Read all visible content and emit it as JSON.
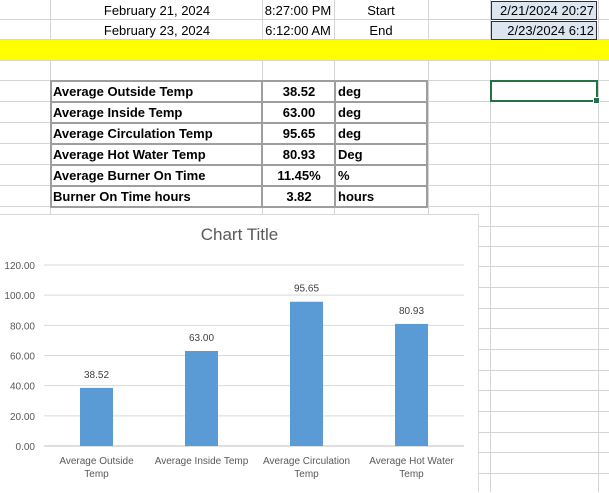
{
  "rows": {
    "start": {
      "date": "February 21, 2024",
      "time": "8:27:00 PM",
      "label": "Start",
      "datetime": "2/21/2024 20:27"
    },
    "end": {
      "date": "February 23, 2024",
      "time": "6:12:00 AM",
      "label": "End",
      "datetime": "2/23/2024 6:12"
    }
  },
  "summary": [
    {
      "label": "Average Outside Temp",
      "value": "38.52",
      "unit": "deg"
    },
    {
      "label": "Average Inside Temp",
      "value": "63.00",
      "unit": "deg"
    },
    {
      "label": "Average Circulation Temp",
      "value": "95.65",
      "unit": "deg"
    },
    {
      "label": "Average Hot Water Temp",
      "value": "80.93",
      "unit": "Deg"
    },
    {
      "label": "Average Burner On Time",
      "value": "11.45%",
      "unit": "%"
    },
    {
      "label": "Burner On Time hours",
      "value": "3.82",
      "unit": "hours"
    }
  ],
  "colors": {
    "highlight": "#ffff00",
    "bar": "#5b9bd5",
    "selection": "#217346",
    "datebox": "#dce6f1"
  },
  "chart_data": {
    "type": "bar",
    "title": "Chart Title",
    "categories": [
      [
        "Average Outside",
        "Temp"
      ],
      [
        "Average Inside Temp"
      ],
      [
        "Average Circulation",
        "Temp"
      ],
      [
        "Average Hot Water",
        "Temp"
      ]
    ],
    "values": [
      38.52,
      63.0,
      95.65,
      80.93
    ],
    "value_labels": [
      "38.52",
      "63.00",
      "95.65",
      "80.93"
    ],
    "yticks": [
      "0.00",
      "20.00",
      "40.00",
      "60.00",
      "80.00",
      "100.00",
      "120.00"
    ],
    "ylim": [
      0,
      120
    ],
    "grid": true,
    "legend": "none"
  }
}
